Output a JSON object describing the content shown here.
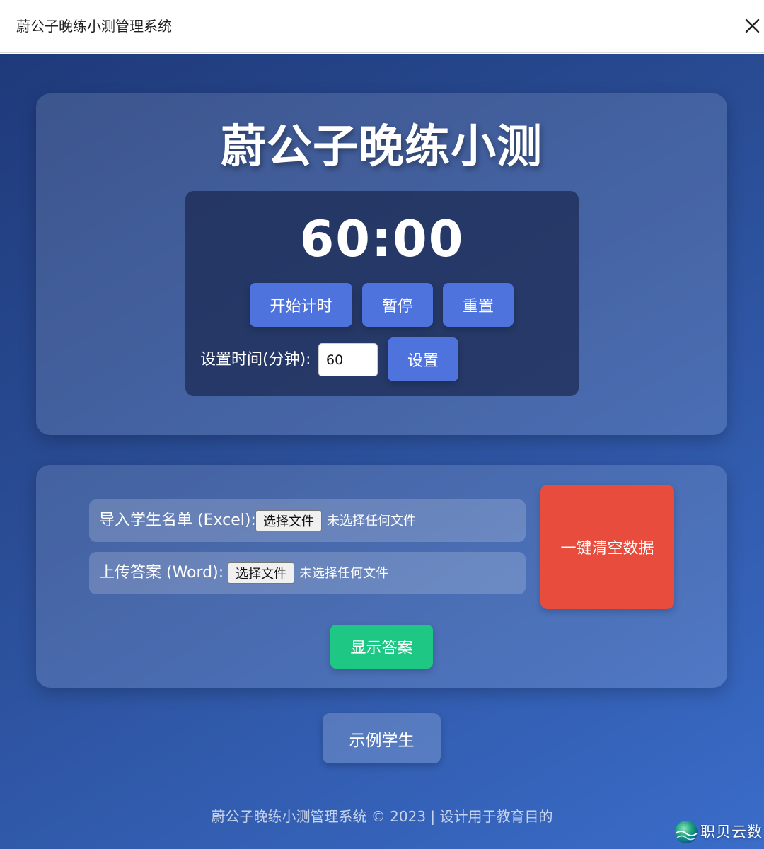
{
  "window": {
    "title": "蔚公子晚练小测管理系统",
    "close_icon": "close-icon"
  },
  "timer_card": {
    "title": "蔚公子晚练小测",
    "display": "60:00",
    "buttons": {
      "start": "开始计时",
      "pause": "暂停",
      "reset": "重置"
    },
    "set_label": "设置时间(分钟):",
    "minutes_value": "60",
    "set_button": "设置"
  },
  "import_card": {
    "excel": {
      "label": "导入学生名单 (Excel):",
      "choose": "选择文件",
      "status": "未选择任何文件"
    },
    "word": {
      "label": "上传答案 (Word):",
      "choose": "选择文件",
      "status": "未选择任何文件"
    },
    "clear_button": "一键清空数据",
    "show_answer_button": "显示答案"
  },
  "sample_button": "示例学生",
  "footer": "蔚公子晚练小测管理系统 © 2023 | 设计用于教育目的",
  "watermark": {
    "text": "职贝云数",
    "logo_icon": "globe-logo-icon"
  },
  "colors": {
    "primary_button": "#4f73dd",
    "danger_button": "#e74c3c",
    "success_button": "#1fc784",
    "background_start": "#1f3a7a",
    "background_end": "#3a6cc9"
  }
}
